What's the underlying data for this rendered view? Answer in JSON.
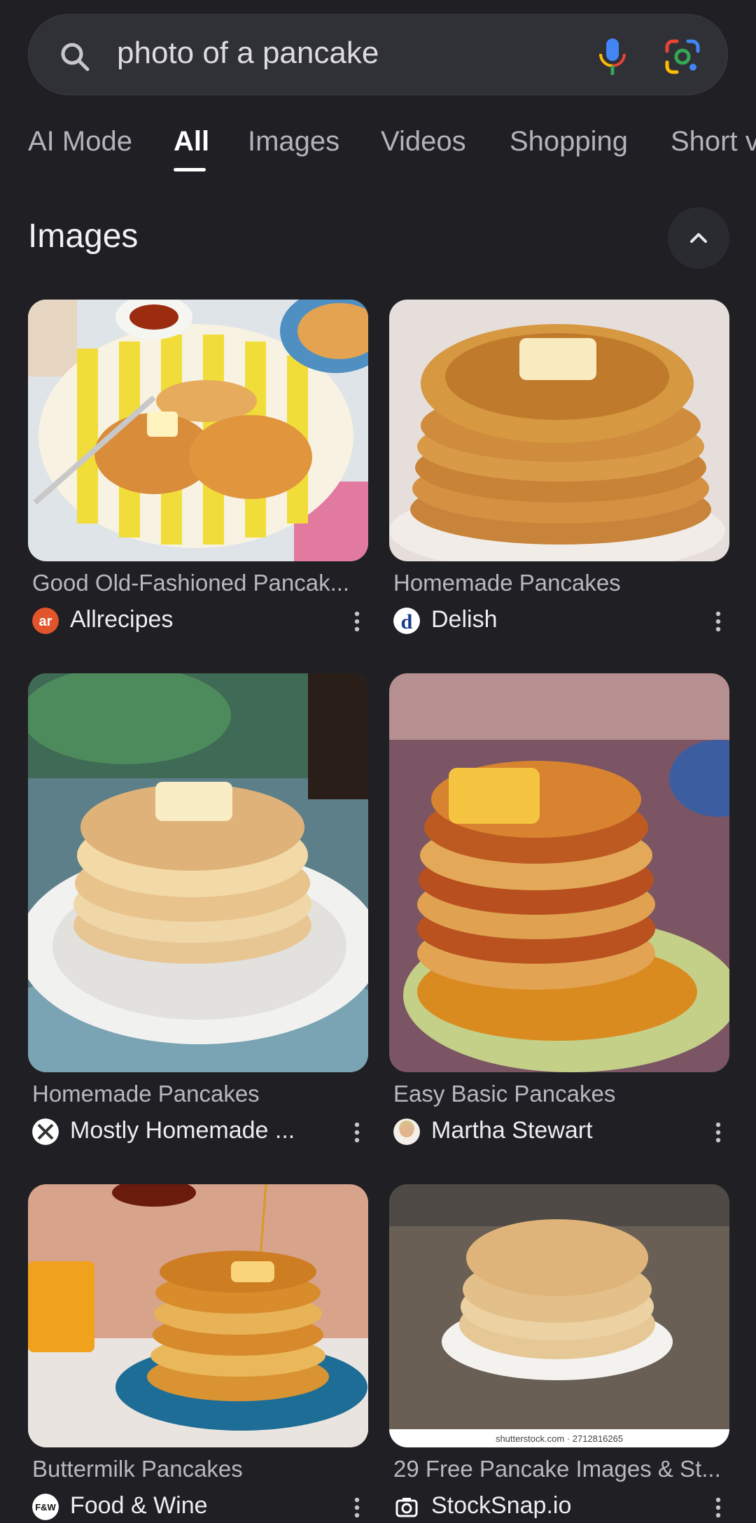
{
  "search": {
    "query": "photo of a pancake"
  },
  "tabs": [
    {
      "label": "AI Mode"
    },
    {
      "label": "All"
    },
    {
      "label": "Images"
    },
    {
      "label": "Videos"
    },
    {
      "label": "Shopping"
    },
    {
      "label": "Short v"
    }
  ],
  "images_section": {
    "title": "Images"
  },
  "results": [
    {
      "title": "Good Old-Fashioned Pancak...",
      "source": "Allrecipes"
    },
    {
      "title": "Homemade Pancakes",
      "source": "Delish"
    },
    {
      "title": "Homemade Pancakes",
      "source": "Mostly Homemade ..."
    },
    {
      "title": "Easy Basic Pancakes",
      "source": "Martha Stewart"
    },
    {
      "title": "Buttermilk Pancakes",
      "source": "Food & Wine"
    },
    {
      "title": "29 Free Pancake Images & St...",
      "source": "StockSnap.io",
      "watermark": "shutterstock.com · 2712816265"
    }
  ],
  "colors": {
    "background": "#1f1f24",
    "search_bar": "#303136",
    "active_tab": "#ffffff"
  }
}
